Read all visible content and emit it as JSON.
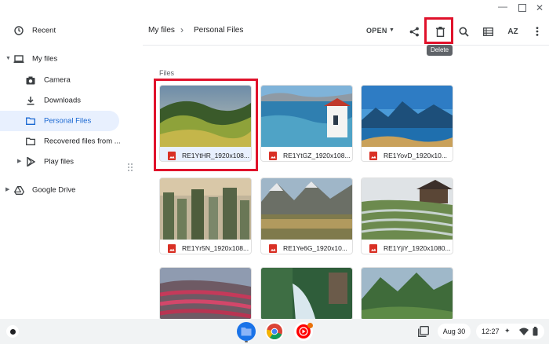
{
  "sidebar": {
    "recent": "Recent",
    "my_files": "My files",
    "camera": "Camera",
    "downloads": "Downloads",
    "personal_files": "Personal Files",
    "recovered": "Recovered files from ...",
    "play_files": "Play files",
    "google_drive": "Google Drive"
  },
  "toolbar": {
    "breadcrumb_root": "My files",
    "breadcrumb_sep": "›",
    "breadcrumb_current": "Personal Files",
    "open_label": "OPEN",
    "sort_label": "AZ",
    "tooltip": "Delete"
  },
  "main": {
    "section_label": "Files",
    "files": [
      {
        "name": "RE1YtHR_1920x108..."
      },
      {
        "name": "RE1YtGZ_1920x108..."
      },
      {
        "name": "RE1YovD_1920x10..."
      },
      {
        "name": "RE1Yr5N_1920x108..."
      },
      {
        "name": "RE1Ye6G_1920x10..."
      },
      {
        "name": "RE1YjiY_1920x1080..."
      }
    ]
  },
  "shelf": {
    "date": "Aug 30",
    "time": "12:27"
  },
  "colors": {
    "accent": "#1967d2",
    "highlight": "#e0122b",
    "active_bg": "#e8f0fe"
  }
}
